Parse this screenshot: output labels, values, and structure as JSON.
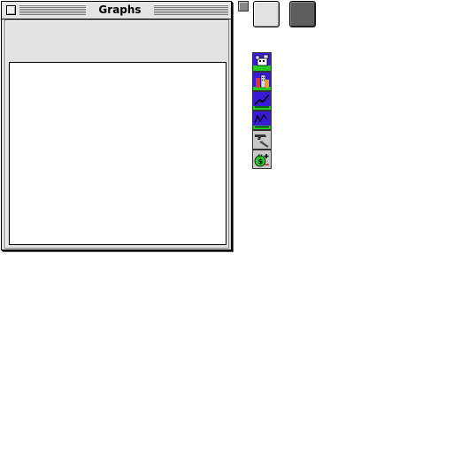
{
  "window": {
    "title": "Graphs"
  },
  "tools": [
    {
      "name": "residential-graph-icon"
    },
    {
      "name": "city-buildings-icon"
    },
    {
      "name": "trend-chart-icon"
    },
    {
      "name": "industrial-chart-icon"
    },
    {
      "name": "crime-gun-icon"
    },
    {
      "name": "money-bag-icon"
    }
  ],
  "colors": {
    "icon_purple": "#3a1ad8",
    "icon_green": "#22cc22",
    "icon_grey": "#c8c8c8"
  }
}
